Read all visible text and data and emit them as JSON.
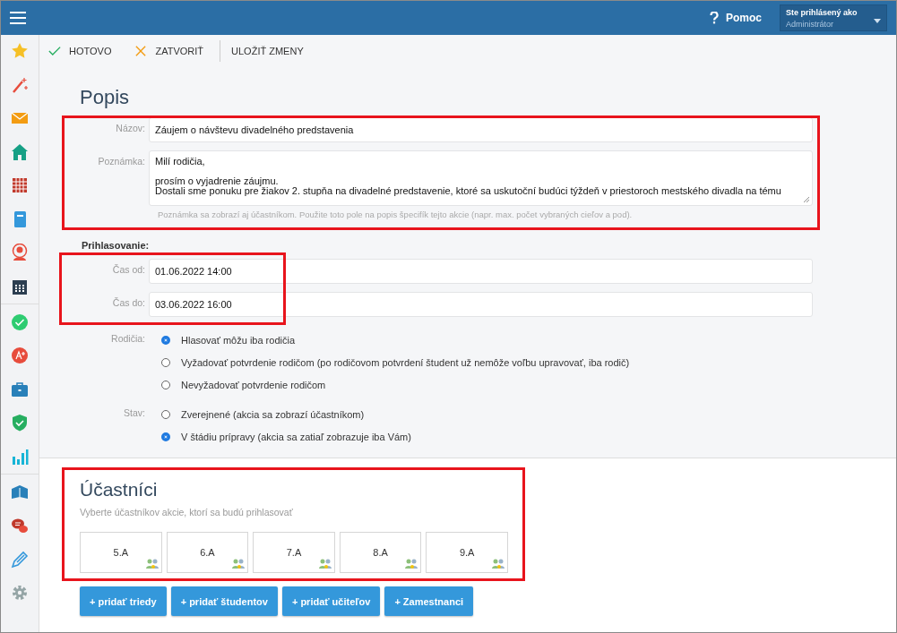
{
  "header": {
    "help": "Pomoc",
    "user_label": "Ste prihlásený ako",
    "user_role": "Administrátor"
  },
  "toolbar": [
    {
      "kind": "done",
      "label": "HOTOVO"
    },
    {
      "kind": "close",
      "label": "ZATVORIŤ"
    },
    {
      "kind": "save",
      "label": "ULOŽIŤ ZMENY"
    }
  ],
  "description": {
    "title": "Popis",
    "highlighted": true,
    "name_label": "Názov:",
    "name_value": "Záujem o návštevu divadelného predstavenia",
    "note_label": "Poznámka:",
    "note_paragraphs": [
      [
        "Milí rodičia,"
      ],
      [
        "prosím o vyjadrenie záujmu.",
        "Dostali sme ponuku pre žiakov 2. stupňa na divadelné predstavenie, ktoré sa uskutoční budúci týždeň v priestoroch mestského divadla na tému"
      ]
    ],
    "note_hint": "Poznámka sa zobrazí aj účastníkom. Použite toto pole na popis špecifík tejto akcie (napr. max. počet vybraných cieľov a pod)."
  },
  "registration": {
    "title": "Prihlasovanie:",
    "times_highlighted": true,
    "from_label": "Čas od:",
    "from_value": "01.06.2022 14:00",
    "to_label": "Čas do:",
    "to_value": "03.06.2022 16:00",
    "groups": [
      {
        "label": "Rodičia:",
        "options": [
          {
            "label": "Hlasovať môžu iba rodičia",
            "selected": true
          },
          {
            "label": "Vyžadovať potvrdenie rodičom (po rodičovom potvrdení študent už nemôže voľbu upravovať, iba rodič)",
            "selected": false
          },
          {
            "label": "Nevyžadovať potvrdenie rodičom",
            "selected": false
          }
        ]
      },
      {
        "label": "Stav:",
        "options": [
          {
            "label": "Zverejnené (akcia sa zobrazí účastníkom)",
            "selected": false
          },
          {
            "label": "V štádiu prípravy (akcia sa zatiaľ zobrazuje iba Vám)",
            "selected": true
          }
        ]
      }
    ]
  },
  "participants": {
    "title": "Účastníci",
    "highlighted": true,
    "subtitle": "Vyberte účastníkov akcie, ktorí sa budú prihlasovať",
    "classes": [
      "5.A",
      "6.A",
      "7.A",
      "8.A",
      "9.A"
    ],
    "buttons": [
      "+ pridať triedy",
      "+ pridať študentov",
      "+ pridať učiteľov",
      "+ Zamestnanci"
    ]
  }
}
